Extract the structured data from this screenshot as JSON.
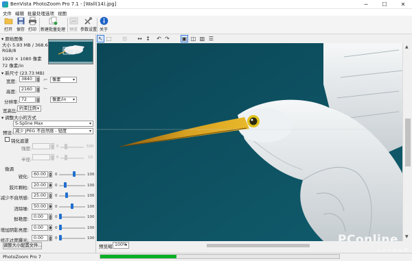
{
  "window": {
    "title": "BenVista PhotoZoom Pro 7.1 - [Wall(14).jpg]",
    "minimize": "─",
    "maximize": "☐",
    "close": "✕"
  },
  "menu": [
    "文件",
    "编辑",
    "批量处理",
    "选项",
    "视图"
  ],
  "toolbar": {
    "open": "打开",
    "save": "保存",
    "print": "打印",
    "batch": "新建批量处理",
    "preview": "预览",
    "settings": "参数设置",
    "about": "关于"
  },
  "original": {
    "header": "原始图像",
    "size": "大小 5.93 MB / 368.64 KB",
    "mode": "RGB/8",
    "dimensions": "1920 × 1080 像素",
    "resolution": "72 像素/in"
  },
  "newsize": {
    "header": "新尺寸 (23.73 MB)",
    "width_label": "宽度:",
    "width_value": "3840",
    "height_label": "高度:",
    "height_value": "2160",
    "res_label": "分辨率:",
    "res_value": "72",
    "unit_px": "像素",
    "unit_res": "像素/in",
    "aspect_label": "宽高比:",
    "aspect_value": "约束比例"
  },
  "method": {
    "header": "调整大小的方式",
    "algorithm": "S-Spline Max",
    "preset_label": "预设:",
    "preset_value": "减少 JPEG 不自然感 - 轻度",
    "unsharp": "钝化遮罩",
    "strength_label": "强度:",
    "strength_min": "0",
    "strength_max": "500",
    "radius_label": "半径:",
    "radius_min": "0",
    "radius_max": "10"
  },
  "finetune": {
    "header": "微调",
    "rows": [
      {
        "label": "锐化:",
        "value": "60.00",
        "min": "0",
        "max": "100",
        "level": 0.6
      },
      {
        "label": "胶片颗粒:",
        "value": "20.00",
        "min": "0",
        "max": "100",
        "level": 0.2
      },
      {
        "label": "减少不自然感:",
        "value": "25.00",
        "min": "0",
        "max": "100",
        "level": 0.25
      },
      {
        "label": "消除噪:",
        "value": "50.00",
        "min": "0",
        "max": "100",
        "level": 0.5
      },
      {
        "label": "鲜艳度:",
        "value": "0.00",
        "min": "0",
        "max": "100",
        "level": 0.0
      },
      {
        "label": "增加阴影亮度:",
        "value": "0.00",
        "min": "0",
        "max": "100",
        "level": 0.0
      },
      {
        "label": "修正过度曝光:",
        "value": "0.00",
        "min": "0",
        "max": "100",
        "level": 0.0
      }
    ],
    "save_preset": "调整大小配置文件..."
  },
  "status": {
    "app": "PhotoZoom Pro 7",
    "zoom_label": "预览缩放:",
    "zoom_value": "100%",
    "progress": 0.32
  },
  "watermark": {
    "brand": "PConline",
    "sub": "太平洋电脑网"
  },
  "colors": {
    "preview_bg": "#0c4e5e",
    "accent": "#1f6fd1",
    "progress": "#06b025"
  }
}
